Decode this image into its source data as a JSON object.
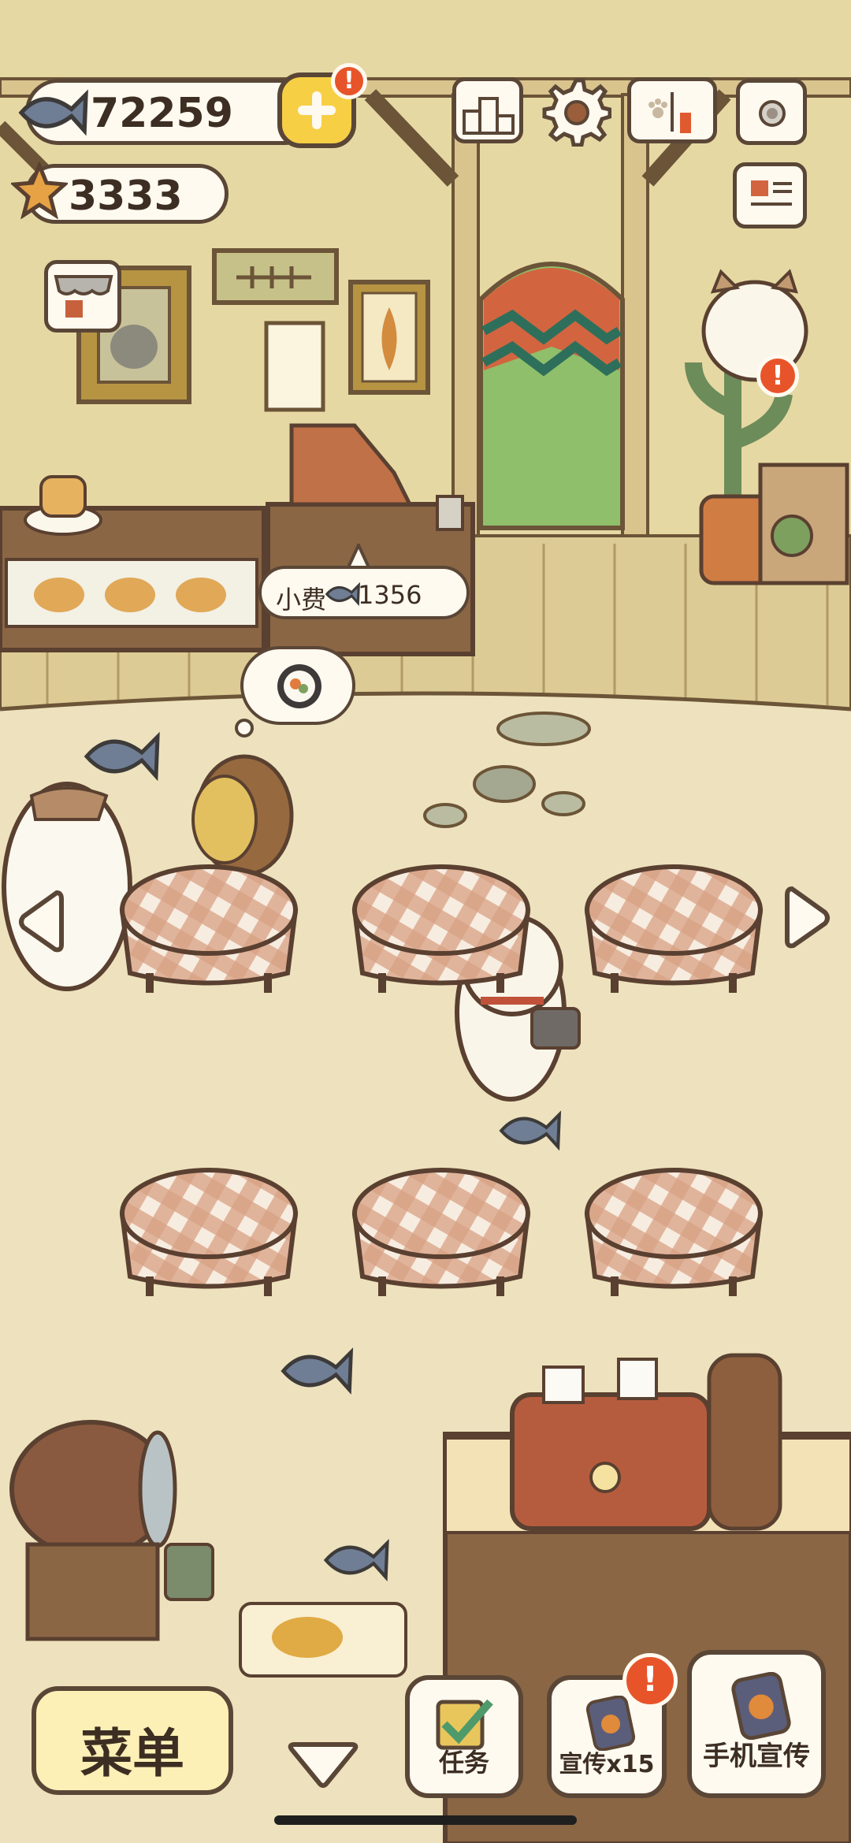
{
  "hud": {
    "fish_count": "72259",
    "star_count": "3333",
    "add_badge": "!",
    "cat_badge": "!",
    "promo_badge": "!"
  },
  "tip_bubble": {
    "label": "小费",
    "amount": "1356"
  },
  "bottom_bar": {
    "menu_label": "菜单",
    "tasks_label": "任务",
    "promo_label": "宣传x15",
    "phone_promo_label": "手机宣传"
  },
  "colors": {
    "outline": "#5a4636",
    "panel": "#fffaf0",
    "accent_yellow": "#f7cf45",
    "badge": "#e8542a",
    "floor": "#ede2bd",
    "wall": "#e6d8a3",
    "tablecloth": "#d8a184"
  }
}
